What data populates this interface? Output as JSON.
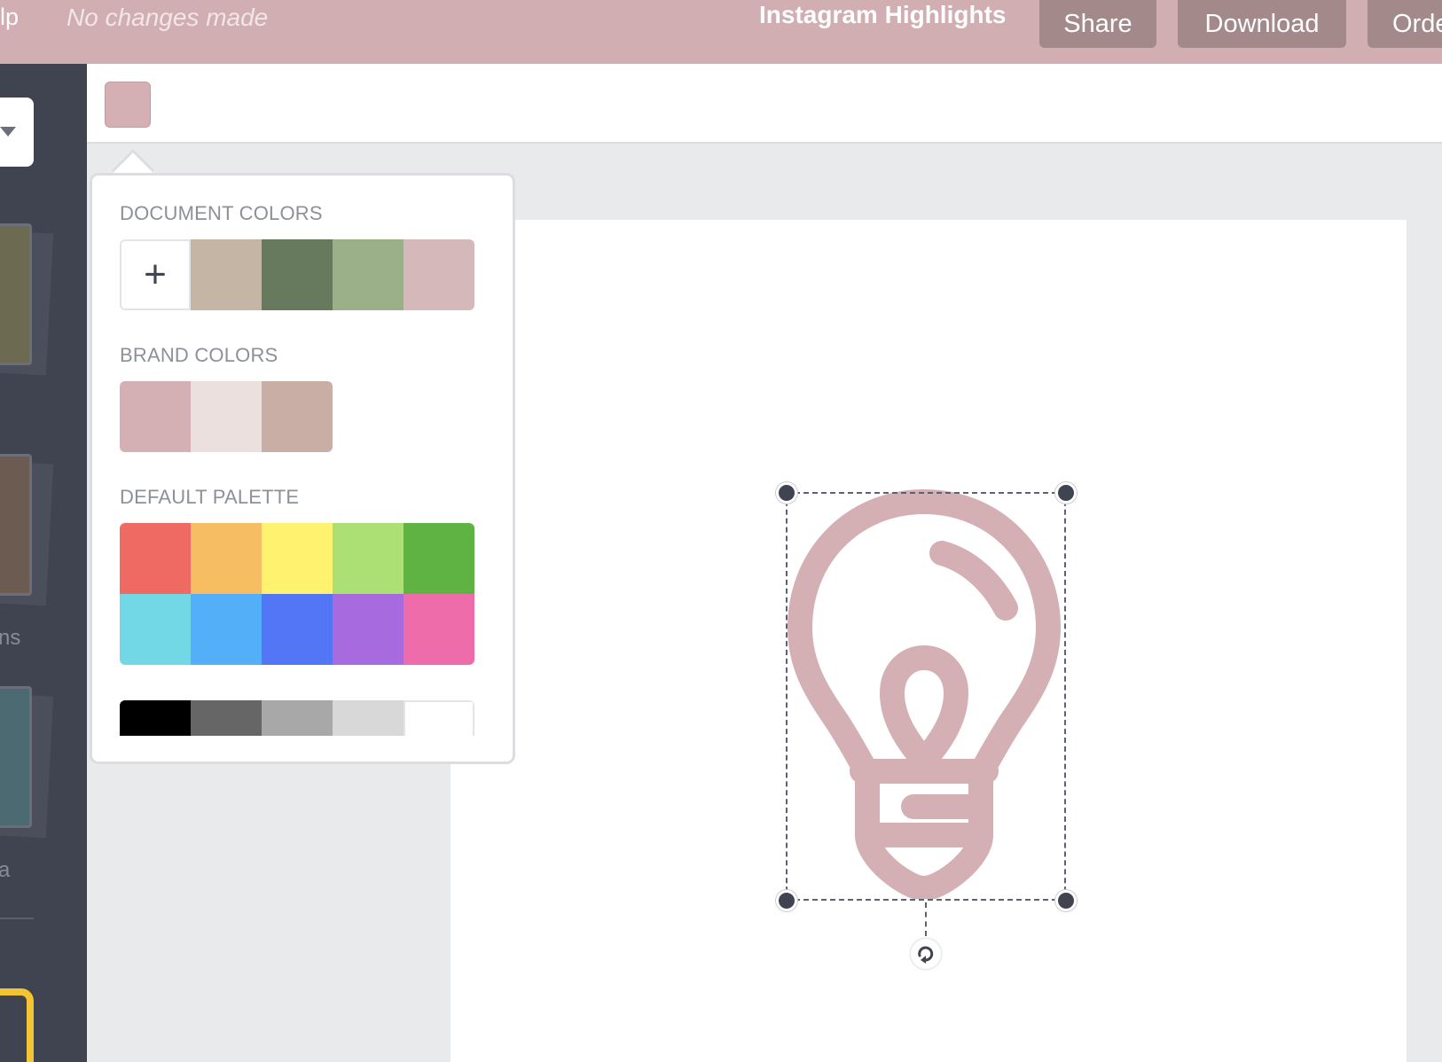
{
  "header": {
    "help_label": "lp",
    "status": "No changes made",
    "document_title": "Instagram Highlights",
    "share_label": "Share",
    "download_label": "Download",
    "order_label": "Orde"
  },
  "sidebar": {
    "labels": [
      "ns",
      "a"
    ]
  },
  "toolbar": {
    "selected_color": "#d4afb4"
  },
  "color_picker": {
    "document_colors_heading": "DOCUMENT COLORS",
    "add_label": "+",
    "document_colors": [
      "#c5b5a4",
      "#677a5e",
      "#9baf89",
      "#d5b8b9"
    ],
    "brand_colors_heading": "BRAND COLORS",
    "brand_colors": [
      "#d4afb4",
      "#ebe0dd",
      "#c9aea6"
    ],
    "default_palette_heading": "DEFAULT PALETTE",
    "default_palette": [
      "#ee6a62",
      "#f6bd62",
      "#fff26f",
      "#acdf74",
      "#5fb342",
      "#72d8e5",
      "#53b0f8",
      "#5376f6",
      "#a86adf",
      "#ef6cab"
    ],
    "grayscale": [
      "#000000",
      "#666666",
      "#a8a8a8",
      "#d8d8d8",
      "#ffffff"
    ]
  },
  "canvas": {
    "icon": "lightbulb-icon",
    "icon_color": "#d4afb4"
  }
}
